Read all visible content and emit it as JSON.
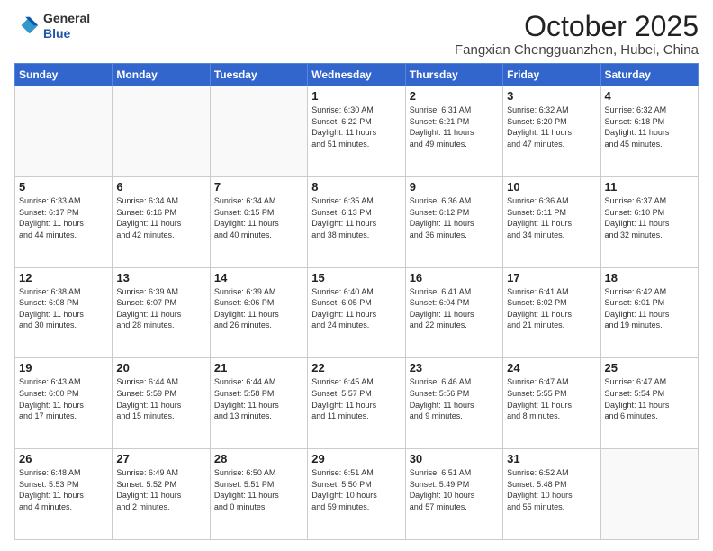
{
  "header": {
    "logo_line1": "General",
    "logo_line2": "Blue",
    "month": "October 2025",
    "location": "Fangxian Chengguanzhen, Hubei, China"
  },
  "days_of_week": [
    "Sunday",
    "Monday",
    "Tuesday",
    "Wednesday",
    "Thursday",
    "Friday",
    "Saturday"
  ],
  "weeks": [
    [
      {
        "day": "",
        "info": ""
      },
      {
        "day": "",
        "info": ""
      },
      {
        "day": "",
        "info": ""
      },
      {
        "day": "1",
        "info": "Sunrise: 6:30 AM\nSunset: 6:22 PM\nDaylight: 11 hours\nand 51 minutes."
      },
      {
        "day": "2",
        "info": "Sunrise: 6:31 AM\nSunset: 6:21 PM\nDaylight: 11 hours\nand 49 minutes."
      },
      {
        "day": "3",
        "info": "Sunrise: 6:32 AM\nSunset: 6:20 PM\nDaylight: 11 hours\nand 47 minutes."
      },
      {
        "day": "4",
        "info": "Sunrise: 6:32 AM\nSunset: 6:18 PM\nDaylight: 11 hours\nand 45 minutes."
      }
    ],
    [
      {
        "day": "5",
        "info": "Sunrise: 6:33 AM\nSunset: 6:17 PM\nDaylight: 11 hours\nand 44 minutes."
      },
      {
        "day": "6",
        "info": "Sunrise: 6:34 AM\nSunset: 6:16 PM\nDaylight: 11 hours\nand 42 minutes."
      },
      {
        "day": "7",
        "info": "Sunrise: 6:34 AM\nSunset: 6:15 PM\nDaylight: 11 hours\nand 40 minutes."
      },
      {
        "day": "8",
        "info": "Sunrise: 6:35 AM\nSunset: 6:13 PM\nDaylight: 11 hours\nand 38 minutes."
      },
      {
        "day": "9",
        "info": "Sunrise: 6:36 AM\nSunset: 6:12 PM\nDaylight: 11 hours\nand 36 minutes."
      },
      {
        "day": "10",
        "info": "Sunrise: 6:36 AM\nSunset: 6:11 PM\nDaylight: 11 hours\nand 34 minutes."
      },
      {
        "day": "11",
        "info": "Sunrise: 6:37 AM\nSunset: 6:10 PM\nDaylight: 11 hours\nand 32 minutes."
      }
    ],
    [
      {
        "day": "12",
        "info": "Sunrise: 6:38 AM\nSunset: 6:08 PM\nDaylight: 11 hours\nand 30 minutes."
      },
      {
        "day": "13",
        "info": "Sunrise: 6:39 AM\nSunset: 6:07 PM\nDaylight: 11 hours\nand 28 minutes."
      },
      {
        "day": "14",
        "info": "Sunrise: 6:39 AM\nSunset: 6:06 PM\nDaylight: 11 hours\nand 26 minutes."
      },
      {
        "day": "15",
        "info": "Sunrise: 6:40 AM\nSunset: 6:05 PM\nDaylight: 11 hours\nand 24 minutes."
      },
      {
        "day": "16",
        "info": "Sunrise: 6:41 AM\nSunset: 6:04 PM\nDaylight: 11 hours\nand 22 minutes."
      },
      {
        "day": "17",
        "info": "Sunrise: 6:41 AM\nSunset: 6:02 PM\nDaylight: 11 hours\nand 21 minutes."
      },
      {
        "day": "18",
        "info": "Sunrise: 6:42 AM\nSunset: 6:01 PM\nDaylight: 11 hours\nand 19 minutes."
      }
    ],
    [
      {
        "day": "19",
        "info": "Sunrise: 6:43 AM\nSunset: 6:00 PM\nDaylight: 11 hours\nand 17 minutes."
      },
      {
        "day": "20",
        "info": "Sunrise: 6:44 AM\nSunset: 5:59 PM\nDaylight: 11 hours\nand 15 minutes."
      },
      {
        "day": "21",
        "info": "Sunrise: 6:44 AM\nSunset: 5:58 PM\nDaylight: 11 hours\nand 13 minutes."
      },
      {
        "day": "22",
        "info": "Sunrise: 6:45 AM\nSunset: 5:57 PM\nDaylight: 11 hours\nand 11 minutes."
      },
      {
        "day": "23",
        "info": "Sunrise: 6:46 AM\nSunset: 5:56 PM\nDaylight: 11 hours\nand 9 minutes."
      },
      {
        "day": "24",
        "info": "Sunrise: 6:47 AM\nSunset: 5:55 PM\nDaylight: 11 hours\nand 8 minutes."
      },
      {
        "day": "25",
        "info": "Sunrise: 6:47 AM\nSunset: 5:54 PM\nDaylight: 11 hours\nand 6 minutes."
      }
    ],
    [
      {
        "day": "26",
        "info": "Sunrise: 6:48 AM\nSunset: 5:53 PM\nDaylight: 11 hours\nand 4 minutes."
      },
      {
        "day": "27",
        "info": "Sunrise: 6:49 AM\nSunset: 5:52 PM\nDaylight: 11 hours\nand 2 minutes."
      },
      {
        "day": "28",
        "info": "Sunrise: 6:50 AM\nSunset: 5:51 PM\nDaylight: 11 hours\nand 0 minutes."
      },
      {
        "day": "29",
        "info": "Sunrise: 6:51 AM\nSunset: 5:50 PM\nDaylight: 10 hours\nand 59 minutes."
      },
      {
        "day": "30",
        "info": "Sunrise: 6:51 AM\nSunset: 5:49 PM\nDaylight: 10 hours\nand 57 minutes."
      },
      {
        "day": "31",
        "info": "Sunrise: 6:52 AM\nSunset: 5:48 PM\nDaylight: 10 hours\nand 55 minutes."
      },
      {
        "day": "",
        "info": ""
      }
    ]
  ]
}
